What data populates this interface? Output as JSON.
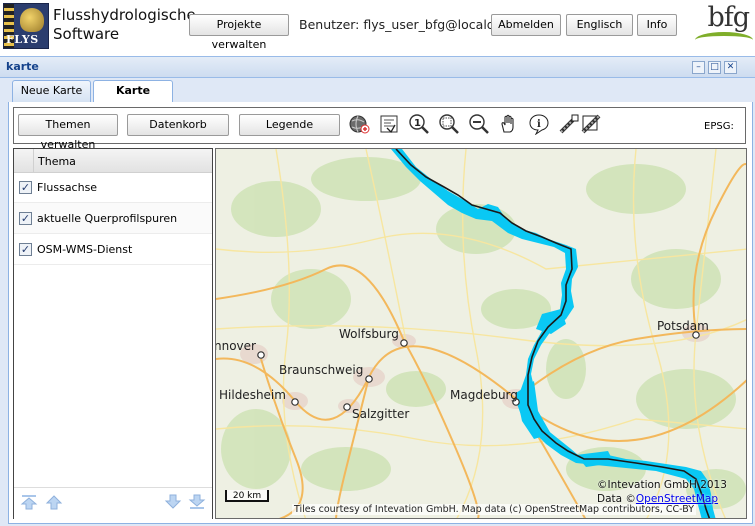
{
  "header": {
    "logo_text": "FLYS",
    "app_title_line1": "Flusshydrologische",
    "app_title_line2": "Software",
    "projects_button": "Projekte verwalten",
    "user_label": "Benutzer: flys_user_bfg@localdb",
    "logout_button": "Abmelden",
    "language_button": "Englisch",
    "info_button": "Info",
    "brand_logo_text": "bfg"
  },
  "window": {
    "title": "karte",
    "tools": [
      "minimize-icon",
      "maximize-icon",
      "close-icon"
    ]
  },
  "tabs": [
    {
      "label": "Neue Karte",
      "active": false
    },
    {
      "label": "Karte",
      "active": true
    }
  ],
  "toolbar": {
    "themes_button": "Themen verwalten",
    "basket_button": "Datenkorb",
    "legend_button": "Legende",
    "icons": [
      "add-wms-globe-icon",
      "print-export-icon",
      "zoom-to-max-icon",
      "zoom-box-icon",
      "zoom-out-icon",
      "pan-hand-icon",
      "info-icon",
      "measure-line-icon",
      "measure-area-icon"
    ],
    "epsg_label": "EPSG:"
  },
  "theme_panel": {
    "header": "Thema",
    "rows": [
      {
        "label": "Flussachse",
        "checked": true
      },
      {
        "label": "aktuelle Querprofilspuren",
        "checked": true
      },
      {
        "label": "OSM-WMS-Dienst",
        "checked": true
      }
    ],
    "footer_icons": [
      "move-to-top-icon",
      "move-up-icon",
      "move-down-icon",
      "move-to-bottom-icon"
    ]
  },
  "map": {
    "cities": [
      "Potsdam",
      "Wolfsburg",
      "nnover",
      "Braunschweig",
      "Hildesheim",
      "Salzgitter",
      "Magdeburg"
    ],
    "scale": "20 km",
    "copyright_line1": "©Intevation GmbH 2013",
    "copyright_line2_prefix": "Data ©",
    "copyright_link": "OpenStreetMap",
    "tiles_credit": "Tiles courtesy of Intevation GmbH. Map data (c) OpenStreetMap contributors, CC-BY"
  },
  "colors": {
    "river": "#0ac8f4",
    "window_header": "#15428b",
    "accent": "#99bbe8"
  }
}
